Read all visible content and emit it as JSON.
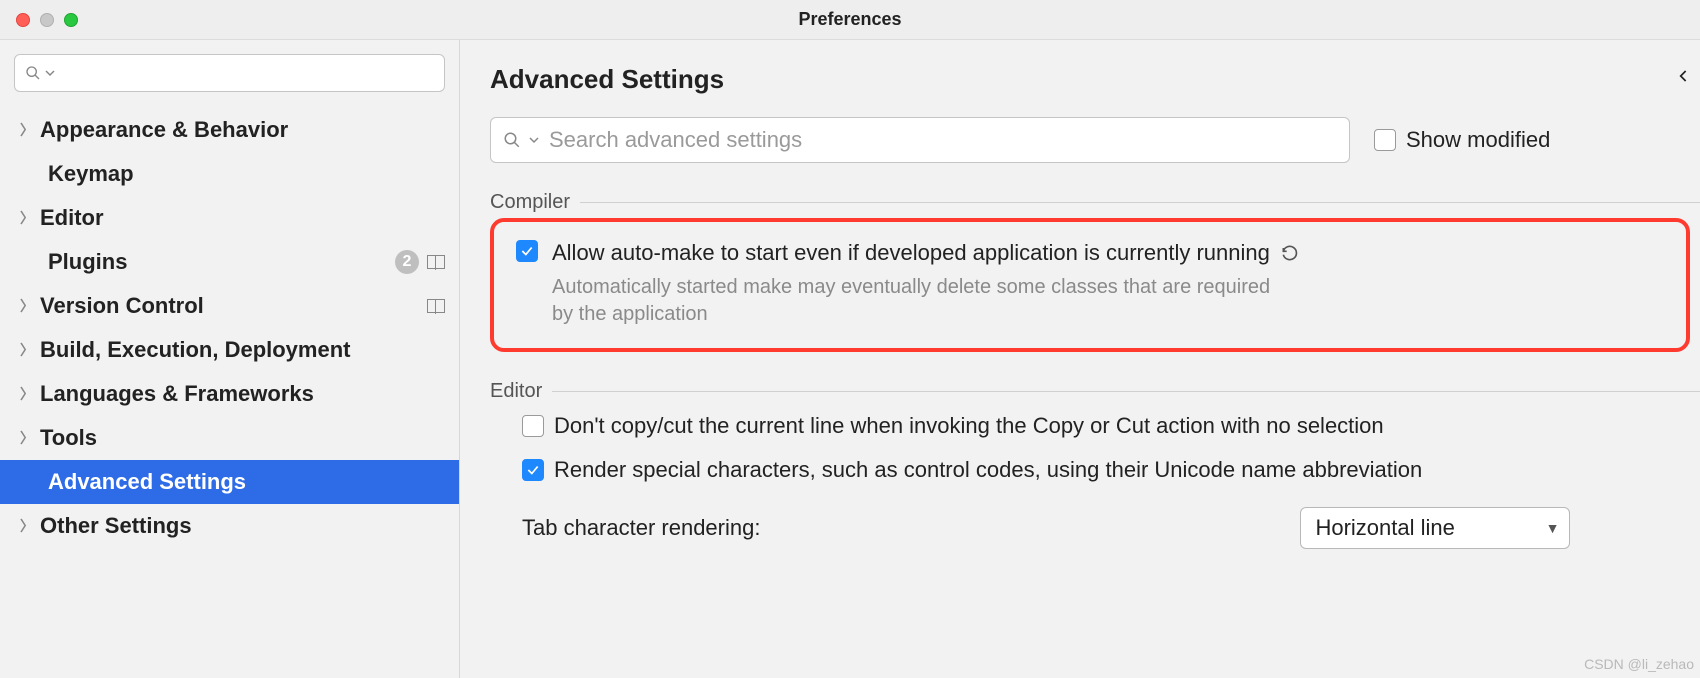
{
  "window": {
    "title": "Preferences"
  },
  "sidebar": {
    "search_value": "",
    "items": [
      {
        "label": "Appearance & Behavior",
        "expandable": true
      },
      {
        "label": "Keymap",
        "expandable": false
      },
      {
        "label": "Editor",
        "expandable": true
      },
      {
        "label": "Plugins",
        "expandable": false,
        "badge": "2",
        "sep": true
      },
      {
        "label": "Version Control",
        "expandable": true,
        "sep": true
      },
      {
        "label": "Build, Execution, Deployment",
        "expandable": true
      },
      {
        "label": "Languages & Frameworks",
        "expandable": true
      },
      {
        "label": "Tools",
        "expandable": true
      },
      {
        "label": "Advanced Settings",
        "expandable": false,
        "selected": true
      },
      {
        "label": "Other Settings",
        "expandable": true
      }
    ]
  },
  "page": {
    "title": "Advanced Settings",
    "search_placeholder": "Search advanced settings",
    "show_modified_label": "Show modified",
    "show_modified_checked": false
  },
  "compiler": {
    "section_label": "Compiler",
    "allow_auto_make_label": "Allow auto-make to start even if developed application is currently running",
    "allow_auto_make_checked": true,
    "allow_auto_make_hint": "Automatically started make may eventually delete some classes that are required by the application"
  },
  "editor": {
    "section_label": "Editor",
    "dont_copy_label": "Don't copy/cut the current line when invoking the Copy or Cut action with no selection",
    "dont_copy_checked": false,
    "render_special_label": "Render special characters, such as control codes, using their Unicode name abbreviation",
    "render_special_checked": true,
    "tab_render_label": "Tab character rendering:",
    "tab_render_value": "Horizontal line"
  },
  "watermark": "CSDN @li_zehao"
}
